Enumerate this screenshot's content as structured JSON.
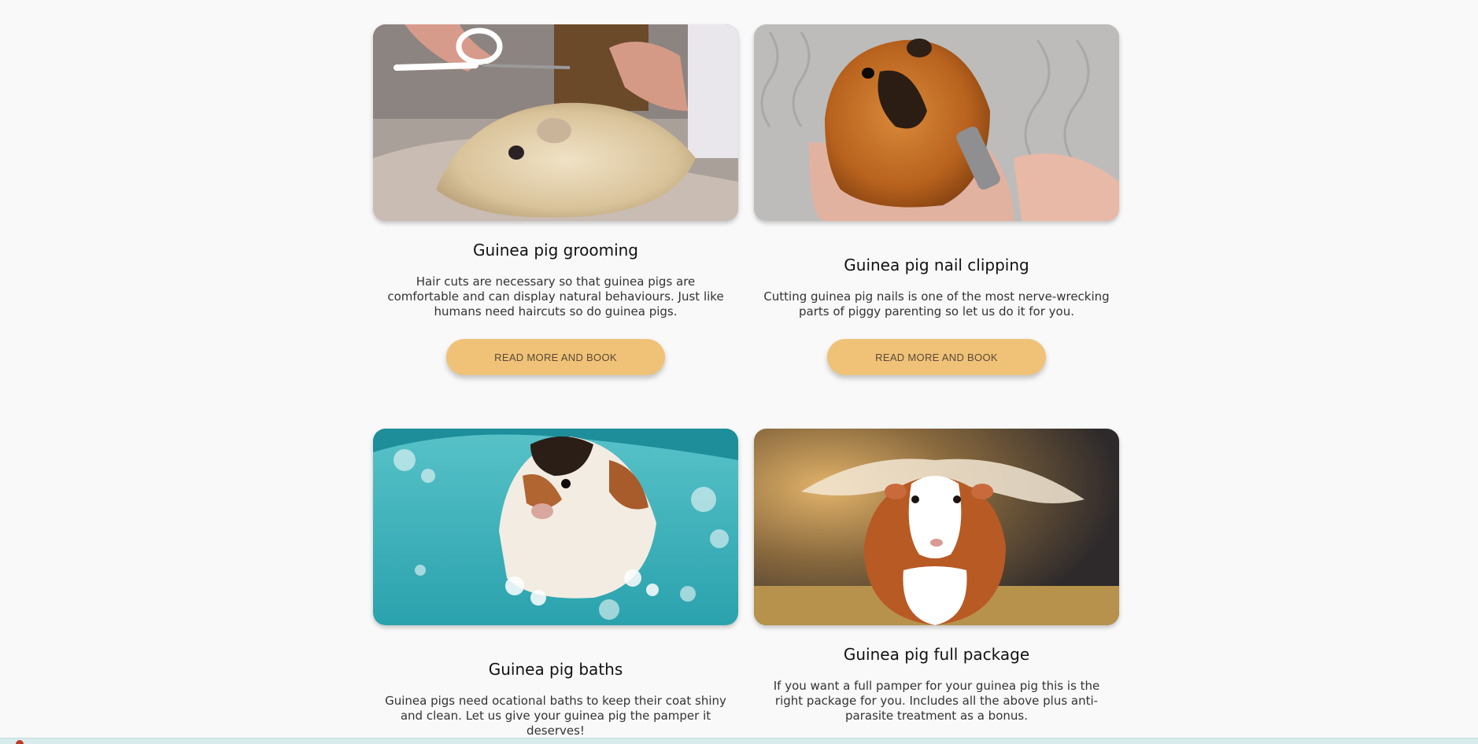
{
  "services": [
    {
      "title": "Guinea pig grooming",
      "description": "Hair cuts are necessary so that guinea pigs are comfortable and can display natural behaviours. Just like humans need haircuts so do guinea pigs.",
      "button_label": "READ MORE AND BOOK",
      "image_alt": "guinea-pig-haircut-photo"
    },
    {
      "title": "Guinea pig nail clipping",
      "description": "Cutting guinea pig nails is one of the most nerve-wrecking parts of piggy parenting so let us do it for you.",
      "button_label": "READ MORE AND BOOK",
      "image_alt": "guinea-pig-nail-clipping-photo"
    },
    {
      "title": "Guinea pig baths",
      "description": "Guinea pigs need ocational baths to keep their coat shiny and clean. Let us give your guinea pig the pamper it deserves!",
      "image_alt": "guinea-pig-bath-photo"
    },
    {
      "title": "Guinea pig full package",
      "description": "If you want a full pamper for your guinea pig this is the right package for you. Includes all the above plus anti-parasite treatment as a bonus.",
      "image_alt": "guinea-pig-full-package-photo"
    }
  ],
  "colors": {
    "page_background": "#f9f9f9",
    "button_background": "#efc278",
    "button_text": "#5a4a36"
  }
}
